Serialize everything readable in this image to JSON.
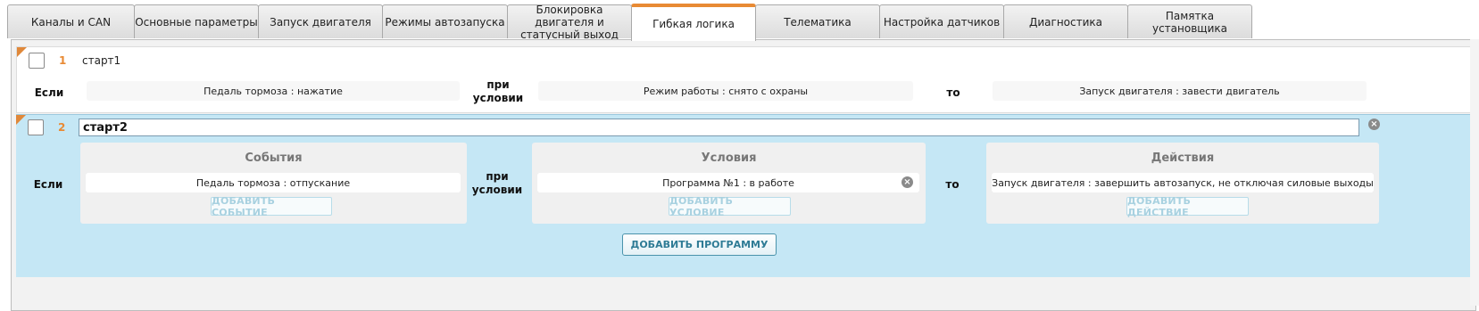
{
  "tabs": [
    {
      "label": "Каналы и CAN"
    },
    {
      "label": "Основные параметры"
    },
    {
      "label": "Запуск двигателя"
    },
    {
      "label": "Режимы автозапуска"
    },
    {
      "label": "Блокировка двигателя и статусный выход"
    },
    {
      "label": "Гибкая логика",
      "active": true
    },
    {
      "label": "Телематика"
    },
    {
      "label": "Настройка датчиков"
    },
    {
      "label": "Диагностика"
    },
    {
      "label": "Памятка установщика"
    }
  ],
  "labels": {
    "if": "Если",
    "condition": "при условии",
    "then": "то"
  },
  "programs": [
    {
      "number": "1",
      "name": "старт1",
      "event": "Педаль тормоза : нажатие",
      "condition": "Режим работы : снято с охраны",
      "action": "Запуск двигателя : завести двигатель"
    },
    {
      "number": "2",
      "name": "старт2",
      "events_title": "События",
      "conditions_title": "Условия",
      "actions_title": "Действия",
      "event": "Педаль тормоза : отпускание",
      "condition": "Программа №1 : в работе",
      "action": "Запуск двигателя : завершить автозапуск, не отключая силовые выходы",
      "add_event": "ДОБАВИТЬ СОБЫТИЕ",
      "add_condition": "ДОБАВИТЬ УСЛОВИЕ",
      "add_action": "ДОБАВИТЬ ДЕЙСТВИЕ"
    }
  ],
  "add_program": "ДОБАВИТЬ ПРОГРАММУ",
  "icons": {
    "remove": "×"
  },
  "colors": {
    "accent": "#e88a34",
    "selected_row": "#c5e7f5",
    "button_text": "#2e7b95"
  }
}
